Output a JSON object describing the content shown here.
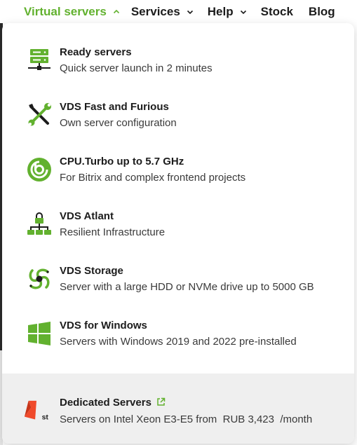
{
  "nav": {
    "items": [
      {
        "label": "Virtual servers",
        "active": true,
        "chevron": "chevron-up-icon"
      },
      {
        "label": "Services",
        "active": false,
        "chevron": "chevron-down-icon"
      },
      {
        "label": "Help",
        "active": false,
        "chevron": "chevron-down-icon"
      },
      {
        "label": "Stock",
        "active": false
      },
      {
        "label": "Blog",
        "active": false
      }
    ]
  },
  "menu": {
    "items": [
      {
        "title": "Ready servers",
        "desc": "Quick server launch in 2 minutes",
        "icon": "server-stack-icon"
      },
      {
        "title": "VDS Fast and Furious",
        "desc": "Own server configuration",
        "icon": "wrench-screwdriver-icon"
      },
      {
        "title": "CPU.Turbo up to 5.7 GHz",
        "desc": "For Bitrix and complex frontend projects",
        "icon": "bitrix-turbo-icon"
      },
      {
        "title": "VDS Atlant",
        "desc": "Resilient Infrastructure",
        "icon": "network-lock-icon"
      },
      {
        "title": "VDS Storage",
        "desc": "Server with a large HDD or NVMe drive up to 5000 GB",
        "icon": "storage-swirl-icon"
      },
      {
        "title": "VDS for Windows",
        "desc": "Servers with Windows 2019 and 2022 pre-installed",
        "icon": "windows-logo-icon"
      }
    ],
    "footer": {
      "title": "Dedicated Servers",
      "desc": "Servers on Intel Xeon E3-E5 from  RUB 3,423  /month",
      "icon": "first-dedic-icon",
      "badge": "st",
      "link_icon": "external-link-icon"
    }
  },
  "colors": {
    "accent": "#62b12f",
    "text": "#1c1c1c",
    "footer_bg": "#efefef",
    "footer_icon": "#f04a2b"
  }
}
